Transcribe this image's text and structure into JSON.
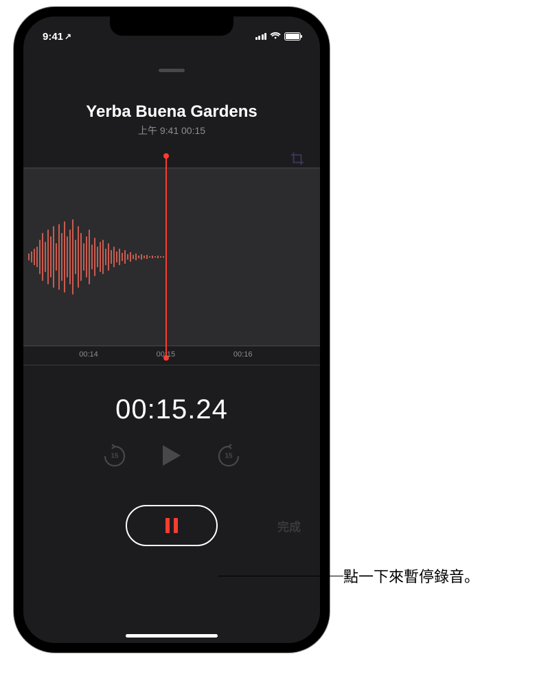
{
  "status": {
    "time": "9:41",
    "location_arrow": "↗"
  },
  "recording": {
    "title": "Yerba Buena Gardens",
    "subtitle": "上午 9:41  00:15",
    "elapsed": "00:15.24"
  },
  "timeline": {
    "marks": [
      {
        "label": "00:14",
        "pos": 22
      },
      {
        "label": "00:15",
        "pos": 48
      },
      {
        "label": "00:16",
        "pos": 74
      }
    ]
  },
  "controls": {
    "skip_back": "15",
    "skip_forward": "15",
    "done": "完成"
  },
  "callout": {
    "text": "點一下來暫停錄音。"
  }
}
